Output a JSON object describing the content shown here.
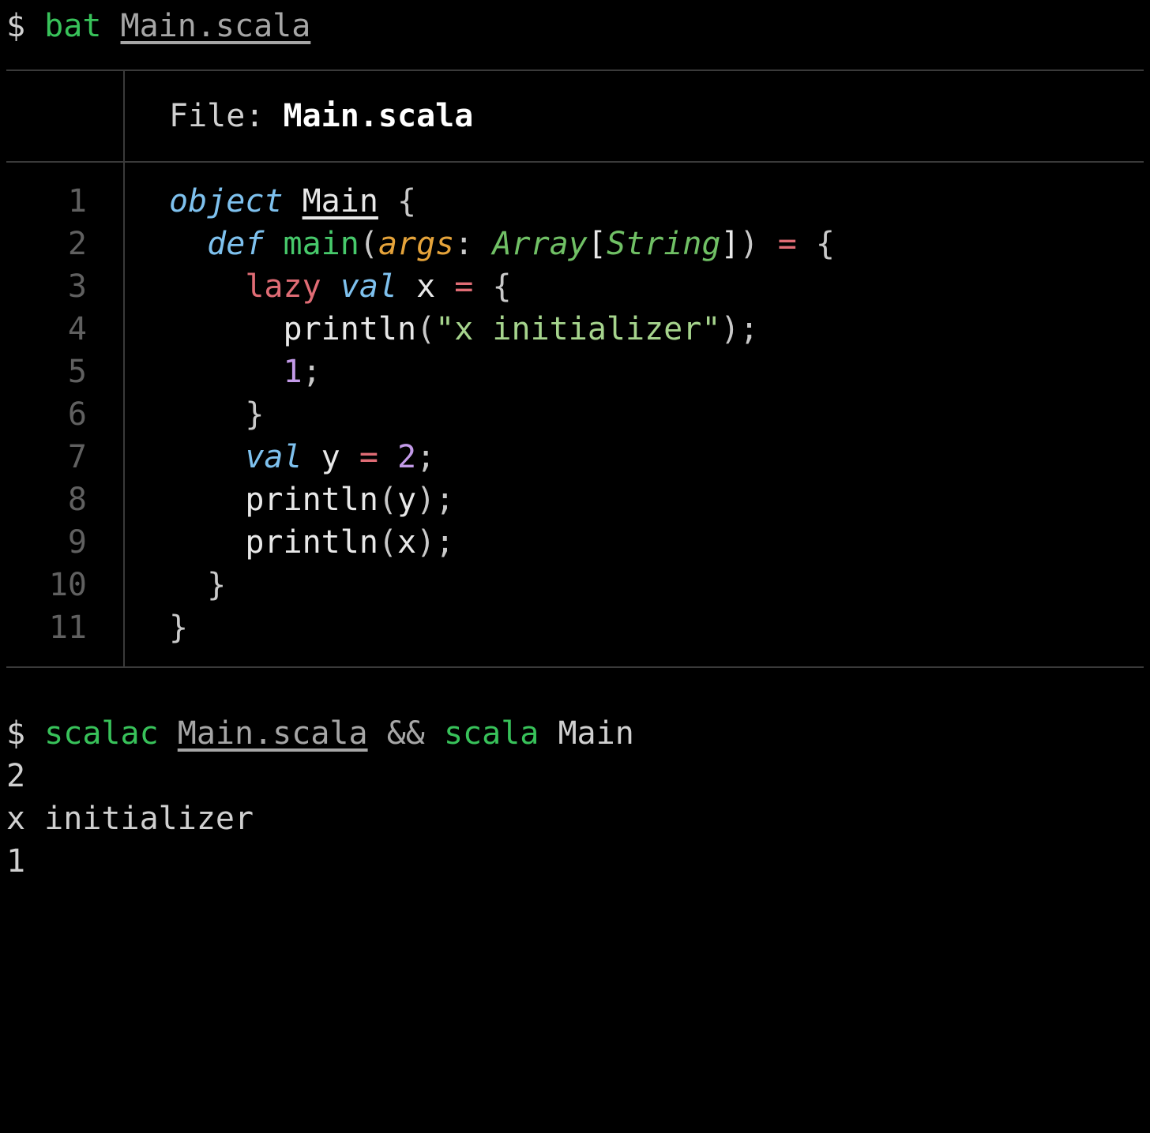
{
  "commands": {
    "prompt": "$ ",
    "cmd1": {
      "exe": "bat",
      "arg": "Main.scala"
    },
    "cmd2": {
      "exe1": "scalac",
      "arg1": "Main.scala",
      "op": "&&",
      "exe2": "scala",
      "arg2": "Main"
    }
  },
  "bat": {
    "file_label": "File: ",
    "file_name": "Main.scala",
    "line_numbers": [
      "1",
      "2",
      "3",
      "4",
      "5",
      "6",
      "7",
      "8",
      "9",
      "10",
      "11"
    ],
    "tokens": {
      "object": "object",
      "Main": "Main",
      "def": "def",
      "main": "main",
      "args": "args",
      "Array": "Array",
      "String": "String",
      "lazy": "lazy",
      "val": "val",
      "x": "x",
      "y": "y",
      "println": "println",
      "str_xinit": "\"x initializer\"",
      "num1": "1",
      "num2": "2",
      "lbrace": "{",
      "rbrace": "}",
      "lparen": "(",
      "rparen": ")",
      "lbrack": "[",
      "rbrack": "]",
      "colon": ": ",
      "eq": " = ",
      "semi": ";",
      "sp": " ",
      "ind2": "  ",
      "ind4": "    ",
      "ind6": "      "
    }
  },
  "output": {
    "lines": {
      "l1": "2",
      "l2": "x initializer",
      "l3": "1"
    }
  }
}
